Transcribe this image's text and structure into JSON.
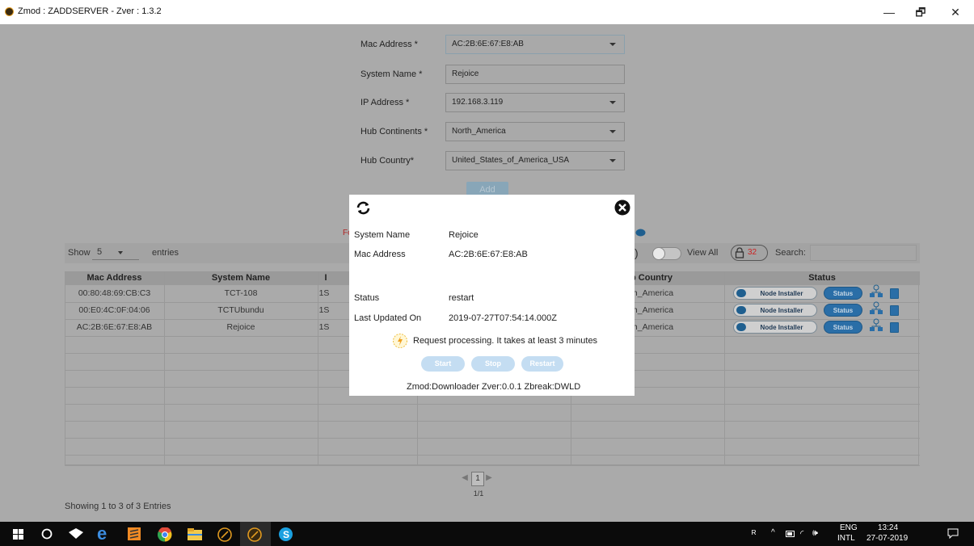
{
  "window": {
    "title": "Zmod : ZADDSERVER - Zver : 1.3.2",
    "minimize": "—",
    "restore": "🗗",
    "close": "✕"
  },
  "form": {
    "mac_label": "Mac Address *",
    "mac_value": "AC:2B:6E:67:E8:AB",
    "system_label": "System Name *",
    "system_value": "Rejoice",
    "ip_label": "IP Address *",
    "ip_value": "192.168.3.119",
    "continent_label": "Hub Continents *",
    "continent_value": "North_America",
    "country_label": "Hub Country*",
    "country_value": "United_States_of_America_USA",
    "add_label": "Add",
    "partial_red": "Fo"
  },
  "table_controls": {
    "show": "Show",
    "entries_value": "5",
    "entries": "entries",
    "view_all": "View All",
    "badge_count": "32",
    "search_label": "Search:"
  },
  "table": {
    "headers": {
      "mac": "Mac Address",
      "system": "System Name",
      "ip_partial": "I",
      "country_partial": "b Country",
      "status": "Status"
    },
    "rows": [
      {
        "mac": "00:80:48:69:CB:C3",
        "system": "TCT-108",
        "ip_partial": "1S",
        "country_partial": "th_America",
        "node": "Node Installer",
        "status": "Status"
      },
      {
        "mac": "00:E0:4C:0F:04:06",
        "system": "TCTUbundu",
        "ip_partial": "1S",
        "country_partial": "th_America",
        "node": "Node Installer",
        "status": "Status"
      },
      {
        "mac": "AC:2B:6E:67:E8:AB",
        "system": "Rejoice",
        "ip_partial": "1S",
        "country_partial": "th_America",
        "node": "Node Installer",
        "status": "Status"
      }
    ]
  },
  "pager": {
    "page": "1",
    "of": "1/1"
  },
  "footer": {
    "showing": "Showing 1 to 3 of 3 Entries"
  },
  "modal": {
    "system_label": "System Name",
    "system_value": "Rejoice",
    "mac_label": "Mac Address",
    "mac_value": "AC:2B:6E:67:E8:AB",
    "status_label": "Status",
    "status_value": "restart",
    "updated_label": "Last Updated On",
    "updated_value": "2019-07-27T07:54:14.000Z",
    "message": "Request processing. It takes at least 3 minutes",
    "start": "Start",
    "stop": "Stop",
    "restart": "Restart",
    "version": "Zmod:Downloader  Zver:0.0.1  Zbreak:DWLD"
  },
  "taskbar": {
    "lang1": "ENG",
    "lang2": "INTL",
    "time": "13:24",
    "date": "27-07-2019"
  },
  "colors": {
    "overlay": "#aaaaaa",
    "accent": "#2a6ea7",
    "badge_red": "#cc2222"
  }
}
